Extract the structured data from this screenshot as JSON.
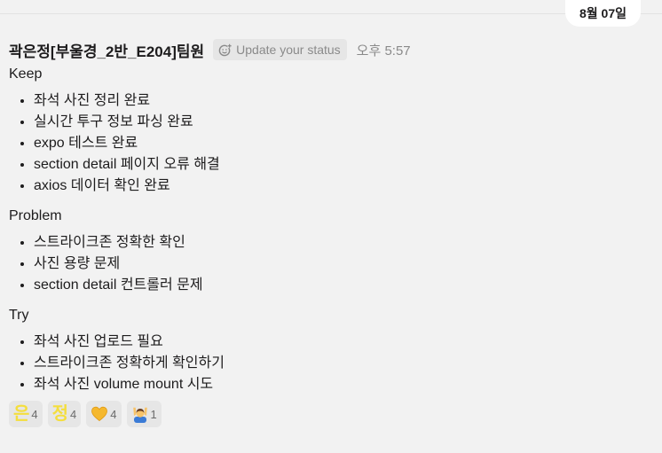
{
  "date_divider": {
    "label": "8월 07일"
  },
  "message": {
    "sender": "곽은정[부울경_2반_E204]팀원",
    "status_button": "Update your status",
    "timestamp": "오후 5:57",
    "sections": [
      {
        "title": "Keep",
        "items": [
          "좌석 사진 정리 완료",
          "실시간 투구 정보 파싱 완료",
          "expo 테스트 완료",
          "section detail 페이지 오류 해결",
          "axios 데이터 확인 완료"
        ]
      },
      {
        "title": "Problem",
        "items": [
          "스트라이크존 정확한 확인",
          "사진 용량 문제",
          "section detail 컨트롤러 문제"
        ]
      },
      {
        "title": "Try",
        "items": [
          "좌석 사진 업로드 필요",
          "스트라이크존 정확하게 확인하기",
          "좌석 사진 volume mount 시도"
        ]
      }
    ]
  },
  "reactions": [
    {
      "emoji": "은",
      "count": "4",
      "icon": "text-emoji-eun"
    },
    {
      "emoji": "정",
      "count": "4",
      "icon": "text-emoji-jeong"
    },
    {
      "emoji": "",
      "count": "4",
      "icon": "yellow-heart-icon"
    },
    {
      "emoji": "",
      "count": "1",
      "icon": "person-raising-hands-icon"
    }
  ],
  "colors": {
    "background": "#f2f2f2",
    "text": "#1d1c1d",
    "muted": "#8a8a8a",
    "reaction_bg": "#e6e6e6",
    "emoji_yellow": "#f4de3e",
    "heart": "#f5b82e"
  }
}
